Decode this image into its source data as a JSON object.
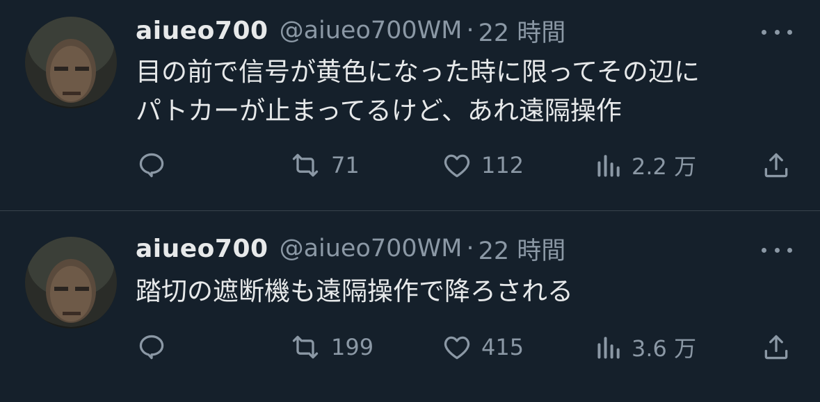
{
  "tweets": [
    {
      "name": "aiueo700",
      "handle": "@aiueo700WM",
      "separator": "·",
      "time": "22 時間",
      "text_lines": [
        "目の前で信号が黄色になった時に限ってその辺に",
        "パトカーが止まってるけど、あれ遠隔操作"
      ],
      "retweets": "71",
      "likes": "112",
      "views": "2.2 万"
    },
    {
      "name": "aiueo700",
      "handle": "@aiueo700WM",
      "separator": "·",
      "time": "22 時間",
      "text_lines": [
        "踏切の遮断機も遠隔操作で降ろされる"
      ],
      "retweets": "199",
      "likes": "415",
      "views": "3.6 万"
    }
  ],
  "icons": [
    "reply-icon",
    "retweet-icon",
    "like-icon",
    "views-icon",
    "share-icon",
    "more-icon"
  ],
  "colors": {
    "background": "#15202b",
    "text": "#e7e9ea",
    "secondary": "#8b98a5",
    "divider": "#38444d"
  }
}
